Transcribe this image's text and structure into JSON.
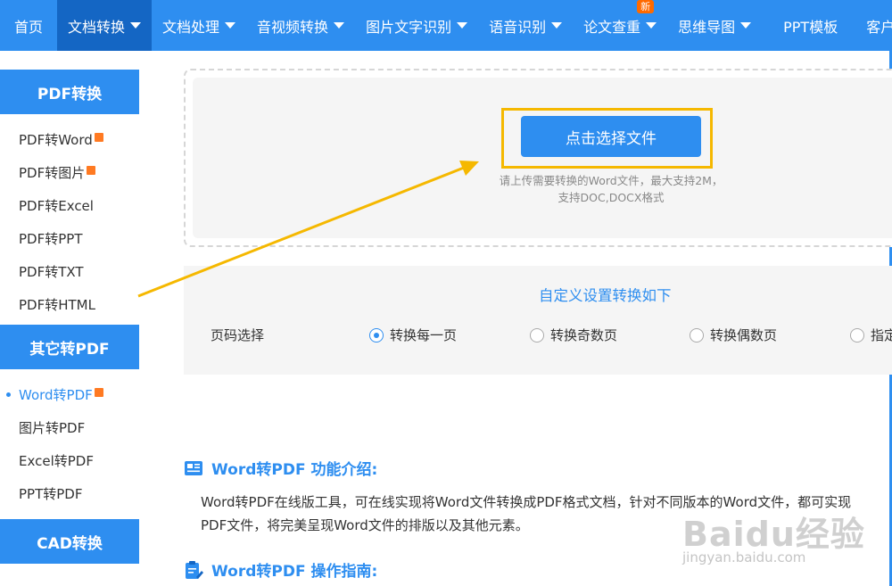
{
  "nav": {
    "items": [
      {
        "label": "首页",
        "caret": false
      },
      {
        "label": "文档转换",
        "caret": true,
        "active": true
      },
      {
        "label": "文档处理",
        "caret": true
      },
      {
        "label": "音视频转换",
        "caret": true
      },
      {
        "label": "图片文字识别",
        "caret": true
      },
      {
        "label": "语音识别",
        "caret": true
      },
      {
        "label": "论文查重",
        "caret": true,
        "badge": "新"
      },
      {
        "label": "思维导图",
        "caret": true
      },
      {
        "label": "PPT模板",
        "caret": false
      },
      {
        "label": "客户",
        "caret": false
      }
    ]
  },
  "sidebar": {
    "sections": [
      {
        "title": "PDF转换",
        "items": [
          {
            "label": "PDF转Word",
            "hot": true
          },
          {
            "label": "PDF转图片",
            "hot": true
          },
          {
            "label": "PDF转Excel"
          },
          {
            "label": "PDF转PPT"
          },
          {
            "label": "PDF转TXT"
          },
          {
            "label": "PDF转HTML"
          }
        ]
      },
      {
        "title": "其它转PDF",
        "items": [
          {
            "label": "Word转PDF",
            "hot": true,
            "active": true
          },
          {
            "label": "图片转PDF"
          },
          {
            "label": "Excel转PDF"
          },
          {
            "label": "PPT转PDF"
          }
        ]
      },
      {
        "title": "CAD转换"
      }
    ]
  },
  "upload": {
    "button_label": "点击选择文件",
    "hint_line1": "请上传需要转换的Word文件，最大支持2M，",
    "hint_line2": "支持DOC,DOCX格式"
  },
  "settings": {
    "title": "自定义设置转换如下",
    "label": "页码选择",
    "options": [
      {
        "label": "转换每一页",
        "checked": true
      },
      {
        "label": "转换奇数页"
      },
      {
        "label": "转换偶数页"
      },
      {
        "label": "指定"
      }
    ]
  },
  "intro": {
    "heading": "Word转PDF 功能介绍:",
    "line1": "Word转PDF在线版工具，可在线实现将Word文件转换成PDF格式文档，针对不同版本的Word文件，都可实现",
    "line2": "PDF文件，将完美呈现Word文件的排版以及其他元素。"
  },
  "guide": {
    "heading": "Word转PDF 操作指南:"
  },
  "watermark": {
    "logo": "Baidu经验",
    "url": "jingyan.baidu.com"
  },
  "colors": {
    "brand": "#2e8ef0",
    "active_nav": "#1466c4",
    "highlight": "#f5b800",
    "badge": "#ff6a00"
  }
}
